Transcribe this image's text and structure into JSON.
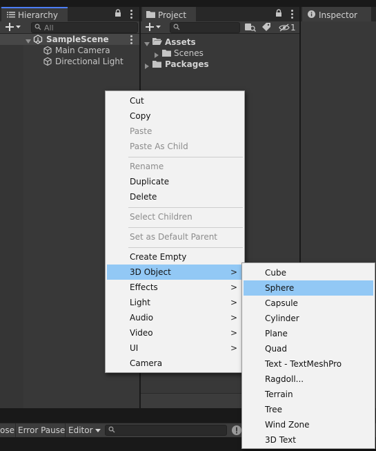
{
  "hierarchy": {
    "tab_label": "Hierarchy",
    "search_placeholder": "All",
    "scene_name": "SampleScene",
    "objects": [
      "Main Camera",
      "Directional Light"
    ]
  },
  "project": {
    "tab_label": "Project",
    "visibility_count": "1",
    "tree": {
      "assets": "Assets",
      "scenes": "Scenes",
      "packages": "Packages"
    }
  },
  "inspector": {
    "tab_label": "Inspector"
  },
  "context_menu": {
    "items": [
      {
        "label": "Cut",
        "enabled": true
      },
      {
        "label": "Copy",
        "enabled": true
      },
      {
        "label": "Paste",
        "enabled": false
      },
      {
        "label": "Paste As Child",
        "enabled": false
      },
      {
        "label": "Rename",
        "enabled": false
      },
      {
        "label": "Duplicate",
        "enabled": true
      },
      {
        "label": "Delete",
        "enabled": true
      },
      {
        "label": "Select Children",
        "enabled": false
      },
      {
        "label": "Set as Default Parent",
        "enabled": false
      },
      {
        "label": "Create Empty",
        "enabled": true
      },
      {
        "label": "3D Object",
        "enabled": true,
        "submenu": true,
        "highlighted": true
      },
      {
        "label": "Effects",
        "enabled": true,
        "submenu": true
      },
      {
        "label": "Light",
        "enabled": true,
        "submenu": true
      },
      {
        "label": "Audio",
        "enabled": true,
        "submenu": true
      },
      {
        "label": "Video",
        "enabled": true,
        "submenu": true
      },
      {
        "label": "UI",
        "enabled": true,
        "submenu": true
      },
      {
        "label": "Camera",
        "enabled": true
      }
    ],
    "submenu_arrow": ">"
  },
  "submenu_3d": {
    "items": [
      {
        "label": "Cube"
      },
      {
        "label": "Sphere",
        "highlighted": true
      },
      {
        "label": "Capsule"
      },
      {
        "label": "Cylinder"
      },
      {
        "label": "Plane"
      },
      {
        "label": "Quad"
      },
      {
        "label": "Text - TextMeshPro"
      },
      {
        "label": "Ragdoll..."
      },
      {
        "label": "Terrain"
      },
      {
        "label": "Tree"
      },
      {
        "label": "Wind Zone"
      },
      {
        "label": "3D Text"
      }
    ]
  },
  "console": {
    "collapse_fragment": "ose",
    "error_pause": "Error Pause",
    "editor_dropdown": "Editor"
  },
  "colors": {
    "highlight": "#92c8f5",
    "accent_tab": "#4c7eff",
    "menu_bg": "#f2f2f2",
    "panel_bg": "#383838"
  }
}
